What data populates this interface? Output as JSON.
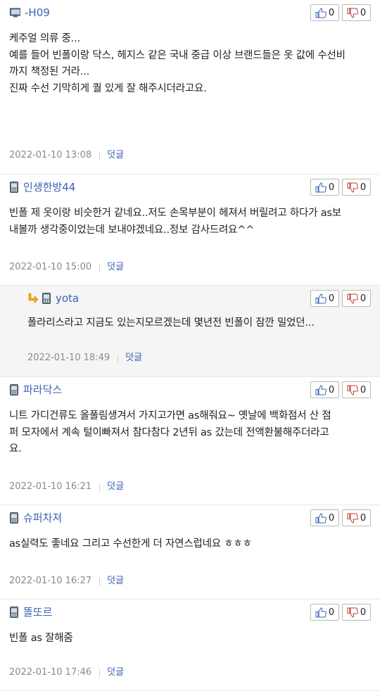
{
  "comments": [
    {
      "author": "-H09",
      "device": "desktop",
      "is_reply": false,
      "body": [
        "케주얼 의류 중...",
        "예를 들어 빈폴이랑 닥스, 헤지스 같은 국내 중급 이상 브랜드들은 옷 값에 수선비",
        "까지 책정된 거라...",
        "진짜 수선 기막히게 퀄 있게 잘 해주시더라고요."
      ],
      "date": "2022-01-10 13:08",
      "reply_label": "덧글",
      "up": "0",
      "down": "0"
    },
    {
      "author": "인생한방44",
      "device": "mobile",
      "is_reply": false,
      "body": [
        "빈폴 제 옷이랑 비슷한거 같네요..저도 손목부분이 헤져서 버릴려고 하다가 as보",
        "내볼까 생각중이었는데 보내야겠네요..정보 감사드려요^^"
      ],
      "date": "2022-01-10 15:00",
      "reply_label": "덧글",
      "up": "0",
      "down": "0"
    },
    {
      "author": "yota",
      "device": "mobile",
      "is_reply": true,
      "body": [
        "폴라리스라고 지금도 있는지모르겠는데 몇년전 빈폴이 잠깐 밀었던..."
      ],
      "date": "2022-01-10 18:49",
      "reply_label": "덧글",
      "up": "0",
      "down": "0"
    },
    {
      "author": "파라닥스",
      "device": "mobile",
      "is_reply": false,
      "body": [
        "니트 가디건류도 올풀림생겨서 가지고가면 as해줘요~ 옛날에 백화점서 산 점",
        "퍼 모자에서 계속 털이빠져서 참다참다 2년뒤 as 갔는데 전액환불해주더라고",
        "요."
      ],
      "date": "2022-01-10 16:21",
      "reply_label": "덧글",
      "up": "0",
      "down": "0"
    },
    {
      "author": "슈퍼차져",
      "device": "mobile",
      "is_reply": false,
      "body": [
        "as실력도 좋네요 그리고 수선한게 더 자연스럽네요 ㅎㅎㅎ"
      ],
      "date": "2022-01-10 16:27",
      "reply_label": "덧글",
      "up": "0",
      "down": "0"
    },
    {
      "author": "똘또르",
      "device": "mobile",
      "is_reply": false,
      "body": [
        "빈폴 as 잘해줌"
      ],
      "date": "2022-01-10 17:46",
      "reply_label": "덧글",
      "up": "0",
      "down": "0"
    }
  ]
}
